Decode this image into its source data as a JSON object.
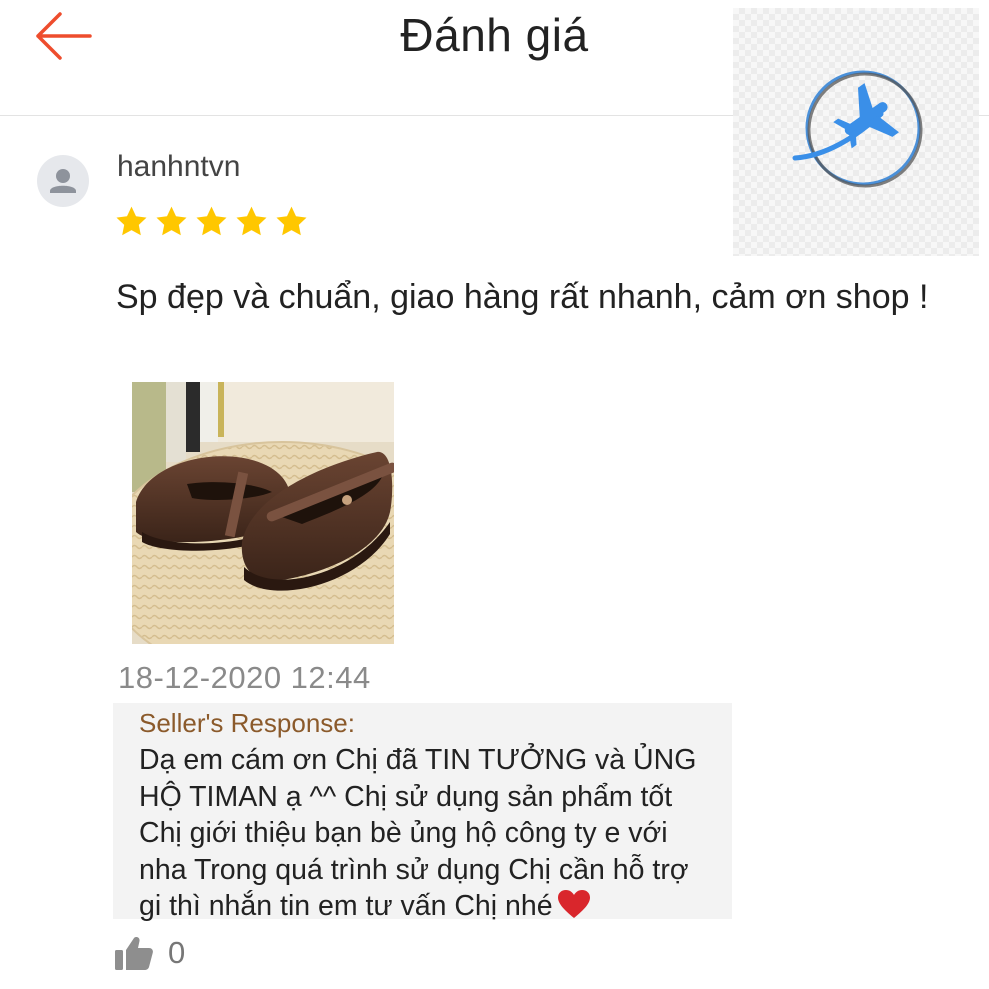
{
  "header": {
    "title": "Đánh giá",
    "back_icon": "arrow-left-icon",
    "accent": "#ee4d2d"
  },
  "review": {
    "username": "hanhntvn",
    "rating": 5,
    "comment": "Sp đẹp và chuẩn, giao hàng rất nhanh, cảm ơn shop !",
    "timestamp": "18-12-2020 12:44",
    "photo_icon": "product-photo-shoes"
  },
  "seller_response": {
    "title": "Seller's Response:",
    "lines": [
      "Dạ em cám ơn  Chị  đã TIN TƯỞNG và ỦNG",
      "HỘ TIMAN ạ ^^  Chị sử dụng sản phẩm tốt",
      "Chị  giới thiệu bạn bè ủng hộ công ty e với",
      "nha Trong quá trình sử dụng  Chị cần hỗ trợ",
      "gi thì nhắn tin em tư vấn  Chị  nhé"
    ]
  },
  "likes": {
    "count": "0",
    "icon": "thumbs-up-icon"
  },
  "colors": {
    "star": "#ffc700",
    "seller_title": "#8b5a2b",
    "seller_bg": "#f3f3f3",
    "heart": "#d9262c"
  }
}
